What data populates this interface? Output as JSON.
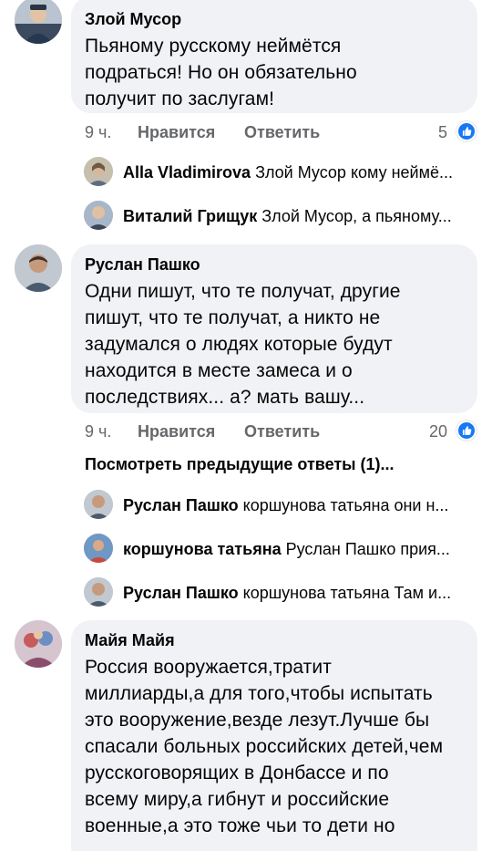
{
  "comments": [
    {
      "author": "Злой Мусор",
      "text": "Пьяному русскому неймётся подраться! Но он обязательно получит по заслугам!",
      "time": "9 ч.",
      "like_label": "Нравится",
      "reply_label": "Ответить",
      "likes": "5",
      "replies": [
        {
          "author": "Alla Vladimirova",
          "text": "Злой Мусор кому неймё..."
        },
        {
          "author": "Виталий Грищук",
          "text": "Злой Мусор, а пьяному..."
        }
      ]
    },
    {
      "author": "Руслан Пашко",
      "text": "Одни пишут, что те получат, другие пишут, что те получат, а никто не задумался о людях  которые будут находится в месте замеса и о последствиях... а? мать вашу...",
      "time": "9 ч.",
      "like_label": "Нравится",
      "reply_label": "Ответить",
      "likes": "20",
      "view_previous": "Посмотреть предыдущие ответы (1)...",
      "replies": [
        {
          "author": "Руслан Пашко",
          "text": "коршунова татьяна они н..."
        },
        {
          "author": "коршунова татьяна",
          "text": "Руслан Пашко прия..."
        },
        {
          "author": "Руслан Пашко",
          "text": "коршунова татьяна Там и..."
        }
      ]
    },
    {
      "author": "Майя Майя",
      "text": "Россия вооружается,тратит миллиарды,а для того,чтобы испытать это вооружение,везде лезут.Лучше бы спасали больных российских детей,чем русскоговорящих в Донбассе и по всему миру,а гибнут и российские военные,а это тоже чьи то дети но"
    }
  ],
  "colors": {
    "bubble": "#f0f2f5",
    "secondary_text": "#65676b",
    "like_blue": "#1877f2"
  },
  "icons": {
    "like": "thumbs-up-icon"
  }
}
